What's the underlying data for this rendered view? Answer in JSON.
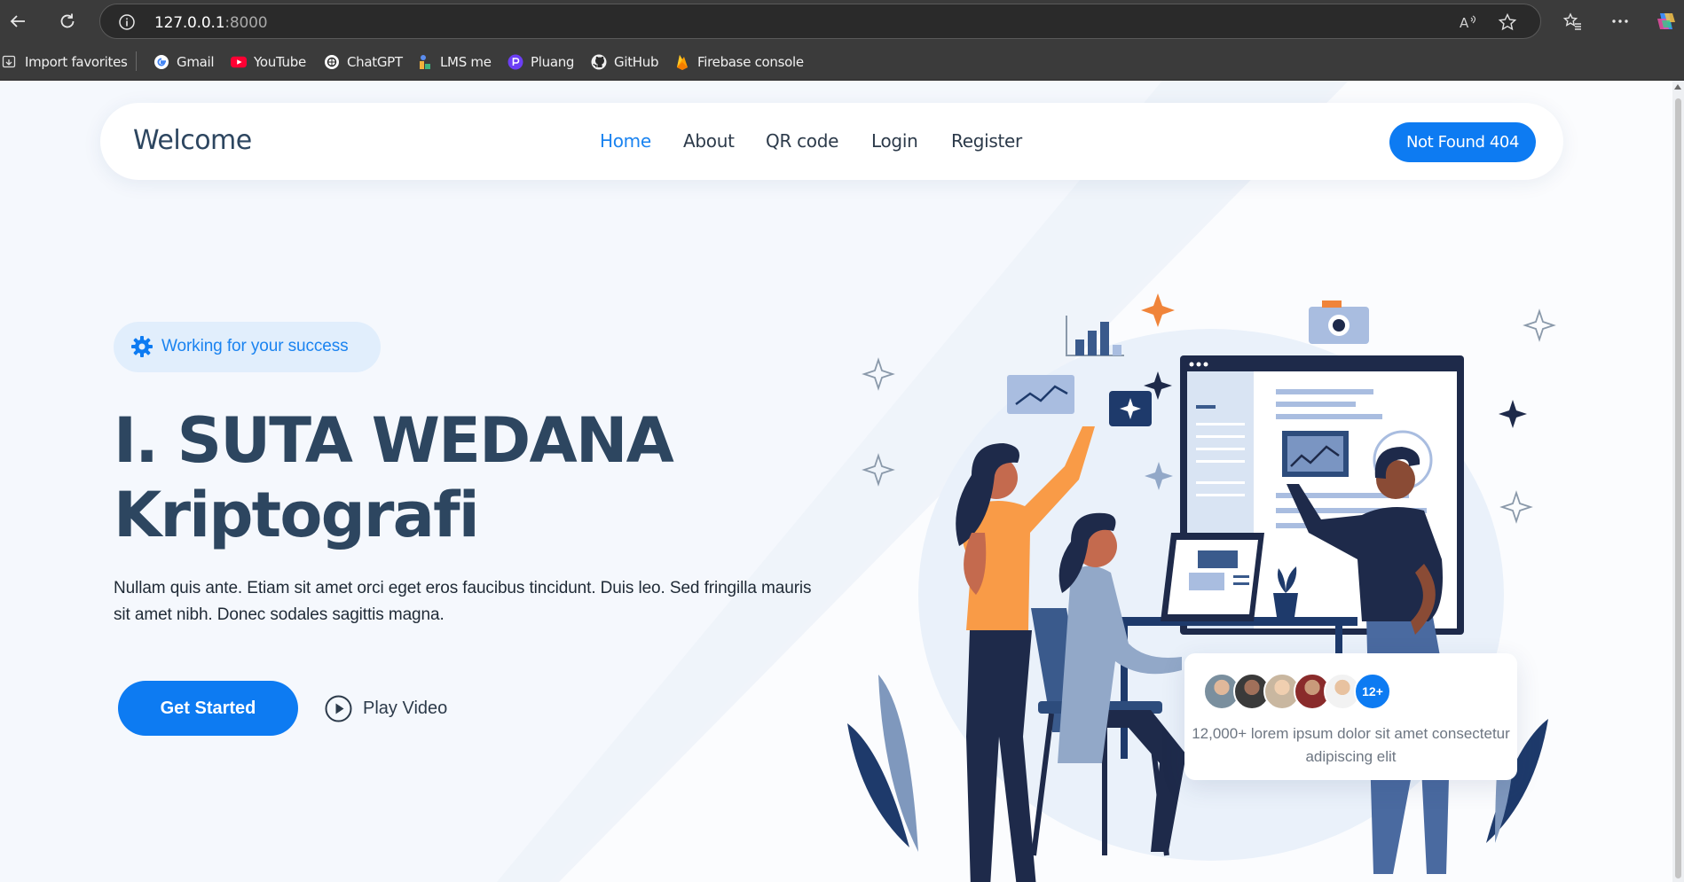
{
  "browser": {
    "url_host": "127.0.0.1",
    "url_port": ":8000",
    "bookmarks": [
      {
        "label": "Import favorites",
        "icon": "import-icon"
      },
      {
        "label": "Gmail",
        "icon": "google-icon"
      },
      {
        "label": "YouTube",
        "icon": "youtube-icon"
      },
      {
        "label": "ChatGPT",
        "icon": "chatgpt-icon"
      },
      {
        "label": "LMS me",
        "icon": "lms-icon"
      },
      {
        "label": "Pluang",
        "icon": "pluang-icon"
      },
      {
        "label": "GitHub",
        "icon": "github-icon"
      },
      {
        "label": "Firebase console",
        "icon": "firebase-icon"
      }
    ]
  },
  "navbar": {
    "brand": "Welcome",
    "links": [
      {
        "label": "Home",
        "active": true
      },
      {
        "label": "About",
        "active": false
      },
      {
        "label": "QR code",
        "active": false
      },
      {
        "label": "Login",
        "active": false
      },
      {
        "label": "Register",
        "active": false
      }
    ],
    "cta": "Not Found 404"
  },
  "hero": {
    "badge": "Working for your success",
    "title_line1": "I. SUTA WEDANA",
    "title_line2": "Kriptografi",
    "description": "Nullam quis ante. Etiam sit amet orci eget eros faucibus tincidunt. Duis leo. Sed fringilla mauris sit amet nibh. Donec sodales sagittis magna.",
    "primary_button": "Get Started",
    "secondary_button": "Play Video"
  },
  "stat_card": {
    "count_badge": "12+",
    "text": "12,000+ lorem ipsum dolor sit amet consectetur adipiscing elit"
  },
  "colors": {
    "accent": "#0d7bf2",
    "heading": "#2d4660",
    "badge_bg": "#e1eefc",
    "orange": "#f99b47",
    "navy": "#1e2a4a"
  }
}
